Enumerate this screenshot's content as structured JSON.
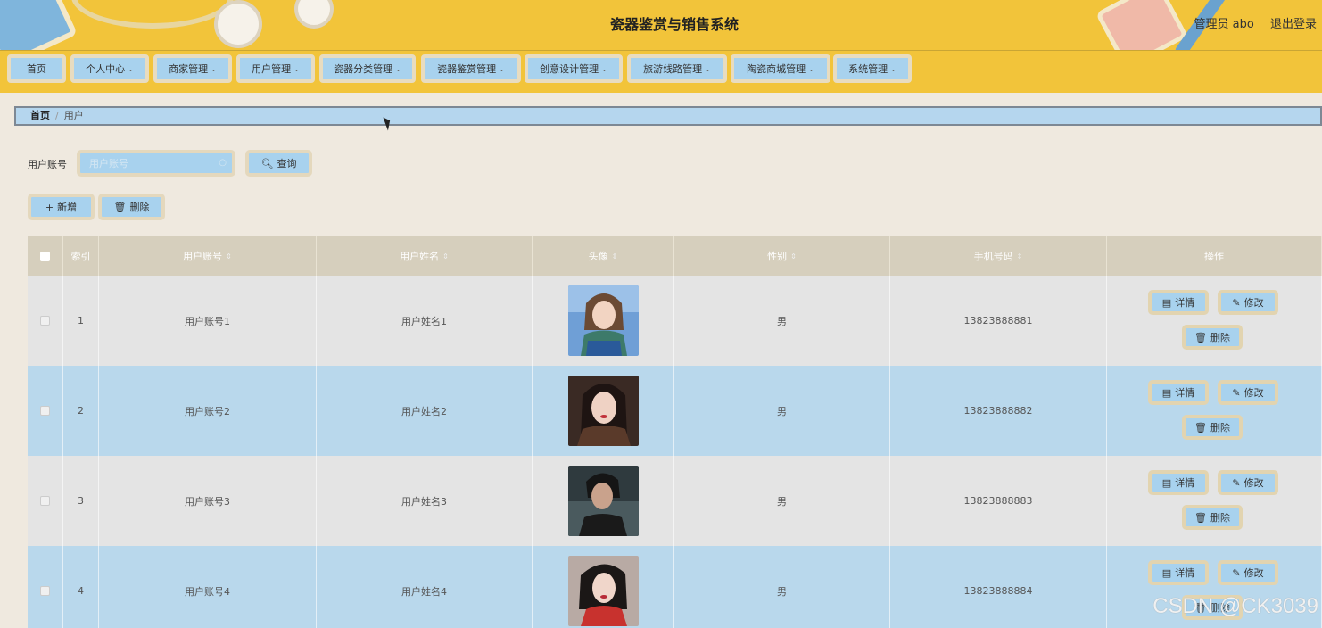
{
  "header": {
    "title": "瓷器鉴赏与销售系统",
    "user_label": "管理员 abo",
    "logout_label": "退出登录"
  },
  "nav": {
    "items": [
      {
        "label": "首页",
        "has_dropdown": false
      },
      {
        "label": "个人中心",
        "has_dropdown": true
      },
      {
        "label": "商家管理",
        "has_dropdown": true
      },
      {
        "label": "用户管理",
        "has_dropdown": true
      },
      {
        "label": "瓷器分类管理",
        "has_dropdown": true
      },
      {
        "label": "瓷器鉴赏管理",
        "has_dropdown": true
      },
      {
        "label": "创意设计管理",
        "has_dropdown": true
      },
      {
        "label": "旅游线路管理",
        "has_dropdown": true
      },
      {
        "label": "陶瓷商城管理",
        "has_dropdown": true
      },
      {
        "label": "系统管理",
        "has_dropdown": true
      }
    ]
  },
  "breadcrumb": {
    "home": "首页",
    "separator": "/",
    "current": "用户"
  },
  "search": {
    "label": "用户账号",
    "placeholder": "用户账号",
    "value": "",
    "button_label": "查询"
  },
  "actions": {
    "add_label": "新增",
    "delete_label": "删除"
  },
  "table": {
    "columns": [
      "索引",
      "用户账号",
      "用户姓名",
      "头像",
      "性别",
      "手机号码",
      "操作"
    ],
    "sortable": [
      false,
      true,
      true,
      true,
      true,
      true,
      false
    ],
    "rows": [
      {
        "index": "1",
        "account": "用户账号1",
        "name": "用户姓名1",
        "gender": "男",
        "phone": "13823888881",
        "avatar": "avatar-woman-sky"
      },
      {
        "index": "2",
        "account": "用户账号2",
        "name": "用户姓名2",
        "gender": "男",
        "phone": "13823888882",
        "avatar": "avatar-woman-dark"
      },
      {
        "index": "3",
        "account": "用户账号3",
        "name": "用户姓名3",
        "gender": "男",
        "phone": "13823888883",
        "avatar": "avatar-man-dark"
      },
      {
        "index": "4",
        "account": "用户账号4",
        "name": "用户姓名4",
        "gender": "男",
        "phone": "13823888884",
        "avatar": "avatar-woman-red"
      }
    ],
    "row_actions": {
      "detail": "详情",
      "edit": "修改",
      "delete": "删除"
    }
  },
  "watermark": "CSDN @CK3039",
  "colors": {
    "header_bg": "#f2c43a",
    "button_bg": "#a8d2ee",
    "row_odd": "#e4e4e4",
    "row_even": "#b9d8ec",
    "thead_bg": "#d6cfbd"
  }
}
